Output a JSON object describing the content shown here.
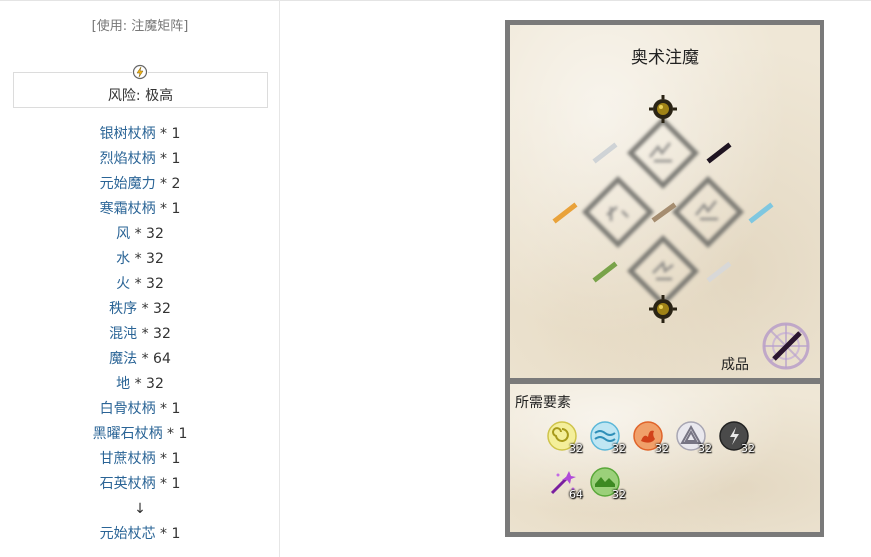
{
  "usage_label": "[使用: 注魔矩阵]",
  "risk_label": "风险: 极高",
  "recipe": [
    {
      "name": "银树杖柄",
      "qty": " * 1"
    },
    {
      "name": "烈焰杖柄",
      "qty": " * 1"
    },
    {
      "name": "元始魔力",
      "qty": " * 2"
    },
    {
      "name": "寒霜杖柄",
      "qty": " * 1"
    },
    {
      "name": "风",
      "qty": " * 32"
    },
    {
      "name": "水",
      "qty": " * 32"
    },
    {
      "name": "火",
      "qty": " * 32"
    },
    {
      "name": "秩序",
      "qty": " * 32"
    },
    {
      "name": "混沌",
      "qty": " * 32"
    },
    {
      "name": "魔法",
      "qty": " * 64"
    },
    {
      "name": "地",
      "qty": " * 32"
    },
    {
      "name": "白骨杖柄",
      "qty": " * 1"
    },
    {
      "name": "黑曜石杖柄",
      "qty": " * 1"
    },
    {
      "name": "甘蔗杖柄",
      "qty": " * 1"
    },
    {
      "name": "石英杖柄",
      "qty": " * 1"
    }
  ],
  "arrow": "↓",
  "result": {
    "name": "元始杖芯",
    "qty": " * 1"
  },
  "panel": {
    "title": "奥术注魔",
    "product_label": "成品",
    "aspects_title": "所需要素"
  },
  "aspects": [
    {
      "icon": "air-aspect-icon",
      "count": "32",
      "color": "#e8e26a"
    },
    {
      "icon": "water-aspect-icon",
      "count": "32",
      "color": "#5bb7d8"
    },
    {
      "icon": "fire-aspect-icon",
      "count": "32",
      "color": "#e0642a"
    },
    {
      "icon": "order-aspect-icon",
      "count": "32",
      "color": "#c9c7d3"
    },
    {
      "icon": "entropy-aspect-icon",
      "count": "32",
      "color": "#3a3a3a"
    },
    {
      "icon": "magic-aspect-icon",
      "count": "64",
      "color": "#8a2bb0"
    },
    {
      "icon": "earth-aspect-icon",
      "count": "32",
      "color": "#5aa83a"
    }
  ],
  "colors": {
    "link": "#2a6496",
    "frame": "#7a7a7a",
    "parchment": "#efe7d6"
  }
}
